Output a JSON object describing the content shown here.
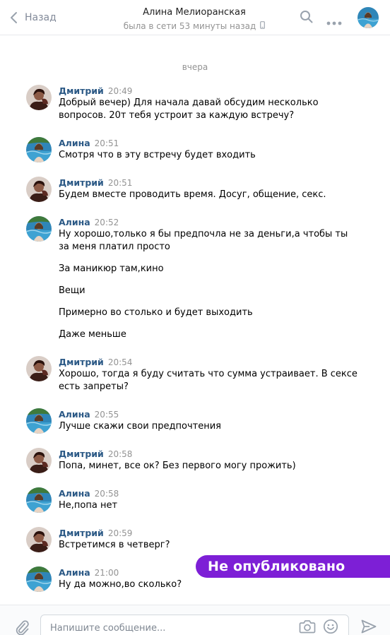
{
  "header": {
    "back_label": "Назад",
    "title": "Алина Мелиоранская",
    "status": "была в сети 53 минуты назад"
  },
  "day_divider": "вчера",
  "colors": {
    "accent": "#2a5885",
    "badge": "#7d1fd6"
  },
  "messages": [
    {
      "author": "Дмитрий",
      "avatar": "dmitry",
      "time": "20:49",
      "lines": [
        "Добрый вечер) Для начала давай обсудим несколько",
        "вопросов. 20т тебя устроит за каждую встречу?"
      ]
    },
    {
      "author": "Алина",
      "avatar": "alina",
      "time": "20:51",
      "lines": [
        "Смотря что в эту встречу будет входить"
      ]
    },
    {
      "author": "Дмитрий",
      "avatar": "dmitry",
      "time": "20:51",
      "lines": [
        "Будем вместе проводить время. Досуг, общение, секс."
      ]
    },
    {
      "author": "Алина",
      "avatar": "alina",
      "time": "20:52",
      "lines": [
        "Ну хорошо,только я бы предпочла не за деньги,а чтобы ты",
        "за меня платил просто",
        "За маникюр там,кино",
        "Вещи",
        "Примерно во столько и будет выходить",
        "Даже меньше"
      ]
    },
    {
      "author": "Дмитрий",
      "avatar": "dmitry",
      "time": "20:54",
      "lines": [
        "Хорошо, тогда я буду считать что сумма устраивает. В сексе",
        "есть запреты?"
      ]
    },
    {
      "author": "Алина",
      "avatar": "alina",
      "time": "20:55",
      "lines": [
        "Лучше скажи свои предпочтения"
      ]
    },
    {
      "author": "Дмитрий",
      "avatar": "dmitry",
      "time": "20:58",
      "lines": [
        "Попа, минет, все ок? Без первого могу прожить)"
      ]
    },
    {
      "author": "Алина",
      "avatar": "alina",
      "time": "20:58",
      "lines": [
        "Не,попа нет"
      ]
    },
    {
      "author": "Дмитрий",
      "avatar": "dmitry",
      "time": "20:59",
      "lines": [
        "Встретимся в четверг?"
      ]
    },
    {
      "author": "Алина",
      "avatar": "alina",
      "time": "21:00",
      "lines": [
        "Ну да можно,во сколько?"
      ]
    }
  ],
  "badge": "Не опубликовано",
  "composer": {
    "placeholder": "Напишите сообщение..."
  },
  "icons": [
    "chevron-left-icon",
    "phone-icon",
    "search-icon",
    "more-icon",
    "paperclip-icon",
    "camera-icon",
    "smile-icon",
    "send-icon"
  ]
}
